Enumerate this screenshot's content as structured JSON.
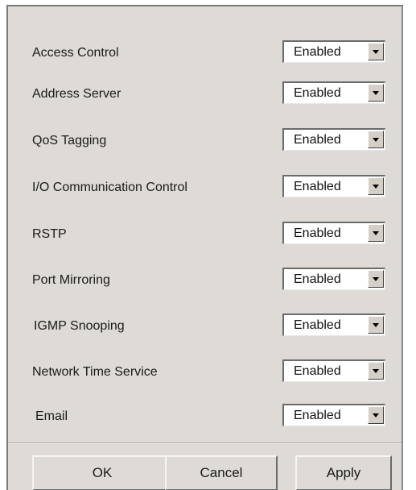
{
  "settings": [
    {
      "label": "Access Control",
      "value": "Enabled"
    },
    {
      "label": "Address Server",
      "value": "Enabled"
    },
    {
      "label": "QoS Tagging",
      "value": "Enabled"
    },
    {
      "label": "I/O Communication Control",
      "value": "Enabled"
    },
    {
      "label": "RSTP",
      "value": "Enabled"
    },
    {
      "label": "Port Mirroring",
      "value": "Enabled"
    },
    {
      "label": "IGMP Snooping",
      "value": "Enabled"
    },
    {
      "label": "Network Time Service",
      "value": "Enabled"
    },
    {
      "label": "Email",
      "value": "Enabled"
    }
  ],
  "buttons": {
    "ok": "OK",
    "cancel": "Cancel",
    "apply": "Apply"
  },
  "icons": {
    "dropdown": "chevron-down-icon"
  },
  "colors": {
    "panel_background": "#dedbd6",
    "field_background": "#ffffff"
  }
}
